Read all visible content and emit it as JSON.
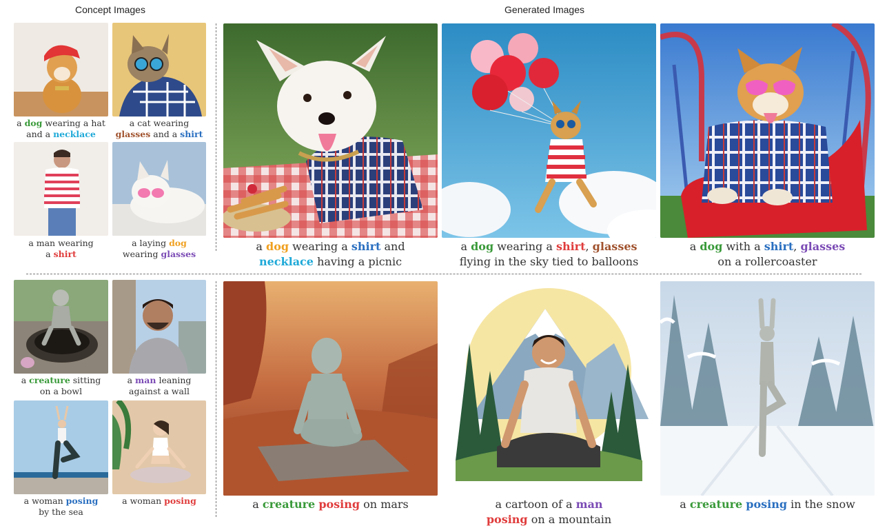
{
  "headers": {
    "concept": "Concept Images",
    "generated": "Generated Images"
  },
  "colors": {
    "green": "#3a9a3a",
    "blue": "#2a6fc0",
    "orange": "#f0a020",
    "red": "#e03c3c",
    "brown": "#a0522d",
    "purple": "#7b4bb5",
    "cyan": "#1ea9d8"
  },
  "concepts": [
    {
      "name": "dog-hat-necklace",
      "caption": [
        [
          {
            "t": "a "
          },
          {
            "t": "dog",
            "c": "green"
          },
          {
            "t": " wearing a hat"
          }
        ],
        [
          {
            "t": "and a "
          },
          {
            "t": "necklace",
            "c": "cyan"
          }
        ]
      ]
    },
    {
      "name": "cat-glasses-shirt",
      "caption": [
        [
          {
            "t": "a cat wearing"
          }
        ],
        [
          {
            "t": "glasses",
            "c": "brown"
          },
          {
            "t": " and a "
          },
          {
            "t": "shirt",
            "c": "blue"
          }
        ]
      ]
    },
    {
      "name": "man-shirt",
      "caption": [
        [
          {
            "t": "a man wearing"
          }
        ],
        [
          {
            "t": "a "
          },
          {
            "t": "shirt",
            "c": "red"
          }
        ]
      ]
    },
    {
      "name": "dog-laying-glasses",
      "caption": [
        [
          {
            "t": "a laying "
          },
          {
            "t": "dog",
            "c": "orange"
          }
        ],
        [
          {
            "t": "wearing "
          },
          {
            "t": "glasses",
            "c": "purple"
          }
        ]
      ]
    },
    {
      "name": "creature-bowl",
      "caption": [
        [
          {
            "t": "a "
          },
          {
            "t": "creature",
            "c": "green"
          },
          {
            "t": " sitting"
          }
        ],
        [
          {
            "t": "on a bowl"
          }
        ]
      ]
    },
    {
      "name": "man-wall",
      "caption": [
        [
          {
            "t": "a "
          },
          {
            "t": "man",
            "c": "purple"
          },
          {
            "t": " leaning"
          }
        ],
        [
          {
            "t": "against a wall"
          }
        ]
      ]
    },
    {
      "name": "woman-sea",
      "caption": [
        [
          {
            "t": "a woman "
          },
          {
            "t": "posing",
            "c": "blue"
          }
        ],
        [
          {
            "t": "by the sea"
          }
        ]
      ]
    },
    {
      "name": "woman-posing",
      "caption": [
        [
          {
            "t": "a woman "
          },
          {
            "t": "posing",
            "c": "red"
          }
        ]
      ]
    }
  ],
  "generated": [
    {
      "name": "dog-picnic",
      "caption": [
        [
          {
            "t": "a "
          },
          {
            "t": "dog",
            "c": "orange"
          },
          {
            "t": " wearing a "
          },
          {
            "t": "shirt",
            "c": "blue"
          },
          {
            "t": " and"
          }
        ],
        [
          {
            "t": "necklace",
            "c": "cyan"
          },
          {
            "t": " having a picnic"
          }
        ]
      ]
    },
    {
      "name": "dog-balloons",
      "caption": [
        [
          {
            "t": "a "
          },
          {
            "t": "dog",
            "c": "green"
          },
          {
            "t": " wearing a "
          },
          {
            "t": "shirt",
            "c": "red"
          },
          {
            "t": ", "
          },
          {
            "t": "glasses",
            "c": "brown"
          }
        ],
        [
          {
            "t": "flying in the sky tied to balloons"
          }
        ]
      ]
    },
    {
      "name": "dog-rollercoaster",
      "caption": [
        [
          {
            "t": "a "
          },
          {
            "t": "dog",
            "c": "green"
          },
          {
            "t": " with a "
          },
          {
            "t": "shirt",
            "c": "blue"
          },
          {
            "t": ", "
          },
          {
            "t": "glasses",
            "c": "purple"
          }
        ],
        [
          {
            "t": "on a rollercoaster"
          }
        ]
      ]
    },
    {
      "name": "creature-mars",
      "caption": [
        [
          {
            "t": "a "
          },
          {
            "t": "creature",
            "c": "green"
          },
          {
            "t": " "
          },
          {
            "t": "posing",
            "c": "red"
          },
          {
            "t": " on mars"
          }
        ]
      ]
    },
    {
      "name": "man-mountain",
      "caption": [
        [
          {
            "t": "a cartoon of a "
          },
          {
            "t": "man",
            "c": "purple"
          }
        ],
        [
          {
            "t": "posing",
            "c": "red"
          },
          {
            "t": " on a mountain"
          }
        ]
      ]
    },
    {
      "name": "creature-snow",
      "caption": [
        [
          {
            "t": "a "
          },
          {
            "t": "creature",
            "c": "green"
          },
          {
            "t": " "
          },
          {
            "t": "posing",
            "c": "blue"
          },
          {
            "t": " in the snow"
          }
        ]
      ]
    }
  ]
}
